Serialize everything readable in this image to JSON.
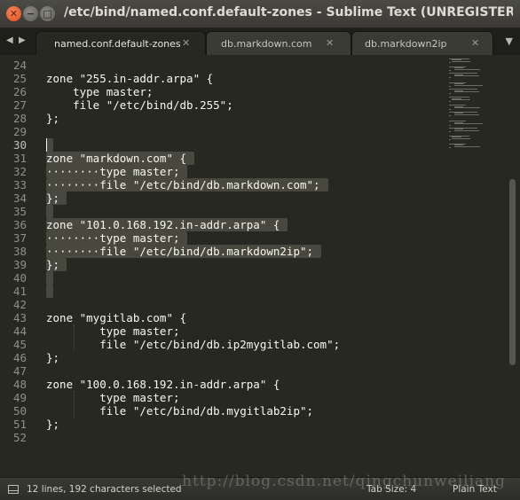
{
  "window": {
    "title": "/etc/bind/named.conf.default-zones - Sublime Text (UNREGISTERED)",
    "close_glyph": "✕",
    "minimize_glyph": "−",
    "maximize_glyph": "□"
  },
  "tabbar": {
    "prev_glyph": "◀",
    "next_glyph": "▶",
    "menu_glyph": "▼",
    "tabs": [
      {
        "label": "named.conf.default-zones",
        "close": "✕",
        "active": true
      },
      {
        "label": "db.markdown.com",
        "close": "✕",
        "active": false
      },
      {
        "label": "db.markdown2ip",
        "close": "✕",
        "active": false
      }
    ]
  },
  "editor": {
    "first_line_number": 24,
    "current_line": 30,
    "lines": [
      "",
      "zone \"255.in-addr.arpa\" {",
      "    type master;",
      "    file \"/etc/bind/db.255\";",
      "};",
      "",
      "",
      "zone \"markdown.com\" {",
      "········type master;",
      "········file \"/etc/bind/db.markdown.com\";",
      "};",
      "",
      "zone \"101.0.168.192.in-addr.arpa\" {",
      "········type master;",
      "········file \"/etc/bind/db.markdown2ip\";",
      "};",
      "",
      "",
      "",
      "zone \"mygitlab.com\" {",
      "        type master;",
      "        file \"/etc/bind/db.ip2mygitlab.com\";",
      "};",
      "",
      "zone \"100.0.168.192.in-addr.arpa\" {",
      "        type master;",
      "        file \"/etc/bind/db.mygitlab2ip\";",
      "};",
      ""
    ],
    "line_numbers": [
      "24",
      "25",
      "26",
      "27",
      "28",
      "29",
      "30",
      "31",
      "32",
      "33",
      "34",
      "35",
      "36",
      "37",
      "38",
      "39",
      "40",
      "41",
      "42",
      "43",
      "44",
      "45",
      "46",
      "47",
      "48",
      "49",
      "50",
      "51",
      "52"
    ]
  },
  "statusbar": {
    "selection": "12 lines, 192 characters selected",
    "tab_size": "Tab Size: 4",
    "syntax": "Plain Text"
  },
  "watermark": "http://blog.csdn.net/qingchunweiliang",
  "colors": {
    "background": "#272822",
    "selection": "#49483e",
    "foreground": "#f8f8f2",
    "gutter": "#8f908a"
  }
}
